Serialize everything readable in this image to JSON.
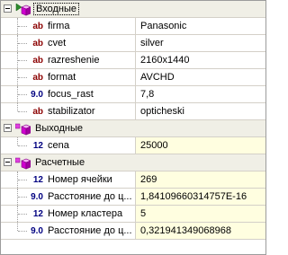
{
  "groups": [
    {
      "label": "Входные",
      "icon": "input-group-icon",
      "properties": [
        {
          "type": "ab",
          "kind": "str",
          "name": "firma",
          "value": "Panasonic"
        },
        {
          "type": "ab",
          "kind": "str",
          "name": "cvet",
          "value": "silver"
        },
        {
          "type": "ab",
          "kind": "str",
          "name": "razreshenie",
          "value": "2160x1440"
        },
        {
          "type": "ab",
          "kind": "str",
          "name": "format",
          "value": "AVCHD"
        },
        {
          "type": "9.0",
          "kind": "dbl",
          "name": "focus_rast",
          "value": "7,8"
        },
        {
          "type": "ab",
          "kind": "str",
          "name": "stabilizator",
          "value": "opticheski"
        }
      ]
    },
    {
      "label": "Выходные",
      "icon": "output-group-icon",
      "properties": [
        {
          "type": "12",
          "kind": "int",
          "name": "cena",
          "value": "25000"
        }
      ]
    },
    {
      "label": "Расчетные",
      "icon": "calculated-group-icon",
      "properties": [
        {
          "type": "12",
          "kind": "int",
          "name": "Номер ячейки",
          "value": "269"
        },
        {
          "type": "9.0",
          "kind": "dbl",
          "name": "Расстояние до ц...",
          "value": "1,84109660314757E-16"
        },
        {
          "type": "12",
          "kind": "int",
          "name": "Номер кластера",
          "value": "5"
        },
        {
          "type": "9.0",
          "kind": "dbl",
          "name": "Расстояние до ц...",
          "value": "0,321941349068968"
        }
      ]
    }
  ],
  "colors": {
    "group_bg": "#f0efe6",
    "readonly_value_bg": "#fffee0",
    "string_type": "#8b0000",
    "numeric_type": "#000080",
    "grid_line": "#d4d0c8"
  }
}
